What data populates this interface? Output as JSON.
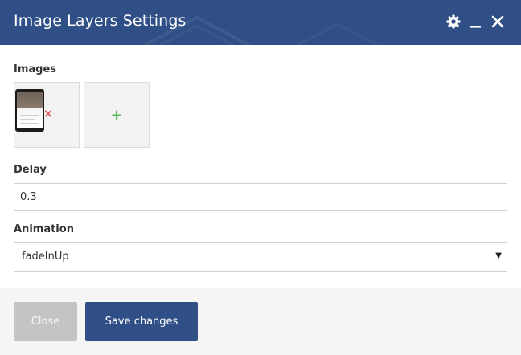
{
  "dialog": {
    "title": "Image Layers Settings",
    "colors": {
      "header": "#2f4f86",
      "primary_button": "#2f4f86",
      "add_icon": "#5cb85c",
      "remove_icon": "#e0555b"
    },
    "header_icons": [
      "gear-icon",
      "minimize-icon",
      "close-icon"
    ]
  },
  "images": {
    "label": "Images",
    "remove_symbol": "×",
    "add_symbol": "+"
  },
  "delay": {
    "label": "Delay",
    "value": "0.3"
  },
  "animation": {
    "label": "Animation",
    "selected": "fadeInUp",
    "caret": "▼"
  },
  "footer": {
    "close_label": "Close",
    "save_label": "Save changes"
  }
}
